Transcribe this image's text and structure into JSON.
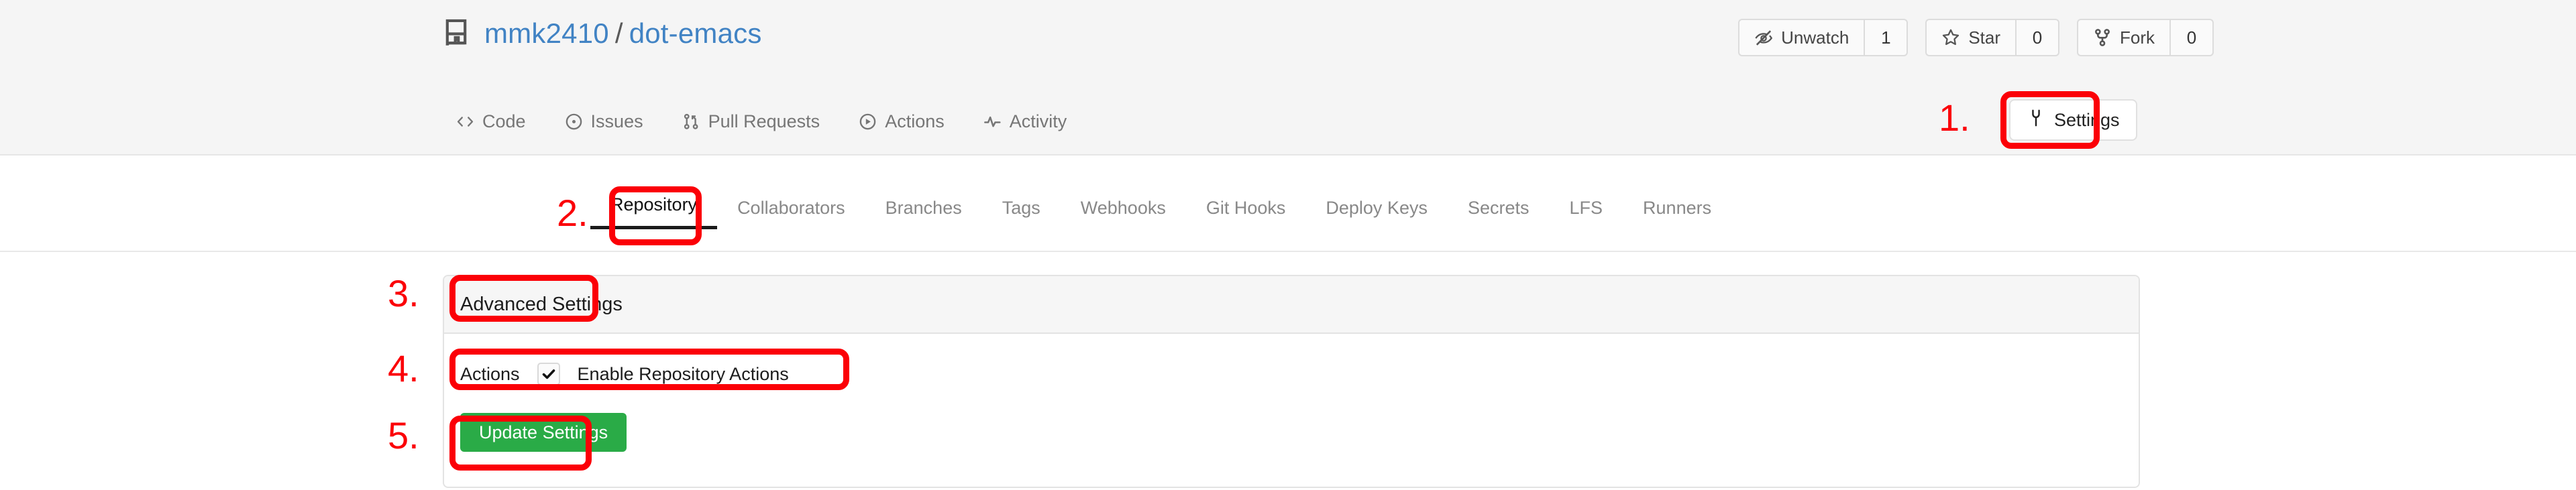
{
  "header": {
    "repo_icon": "repo-book-icon",
    "owner": "mmk2410",
    "separator": "/",
    "repo_name": "dot-emacs",
    "actions": [
      {
        "icon": "eye-closed-icon",
        "label": "Unwatch",
        "count": "1"
      },
      {
        "icon": "star-icon",
        "label": "Star",
        "count": "0"
      },
      {
        "icon": "fork-icon",
        "label": "Fork",
        "count": "0"
      }
    ]
  },
  "nav": {
    "items": [
      {
        "icon": "code-icon",
        "label": "Code"
      },
      {
        "icon": "issue-circle-icon",
        "label": "Issues"
      },
      {
        "icon": "pull-request-icon",
        "label": "Pull Requests"
      },
      {
        "icon": "play-circle-icon",
        "label": "Actions"
      },
      {
        "icon": "activity-pulse-icon",
        "label": "Activity"
      }
    ],
    "settings": {
      "icon": "wrench-icon",
      "label": "Settings"
    }
  },
  "settings_tabs": [
    {
      "label": "Repository",
      "active": true
    },
    {
      "label": "Collaborators",
      "active": false
    },
    {
      "label": "Branches",
      "active": false
    },
    {
      "label": "Tags",
      "active": false
    },
    {
      "label": "Webhooks",
      "active": false
    },
    {
      "label": "Git Hooks",
      "active": false
    },
    {
      "label": "Deploy Keys",
      "active": false
    },
    {
      "label": "Secrets",
      "active": false
    },
    {
      "label": "LFS",
      "active": false
    },
    {
      "label": "Runners",
      "active": false
    }
  ],
  "panel": {
    "title": "Advanced Settings",
    "actions_label": "Actions",
    "enable_actions_label": "Enable Repository Actions",
    "enable_actions_checked": true,
    "update_button": "Update Settings"
  },
  "annotations": [
    {
      "number": "1."
    },
    {
      "number": "2."
    },
    {
      "number": "3."
    },
    {
      "number": "4."
    },
    {
      "number": "5."
    }
  ],
  "colors": {
    "link_blue": "#4183c4",
    "annotation_red": "#fb0007",
    "button_green": "#2aab47",
    "header_bg": "#f5f5f5"
  }
}
